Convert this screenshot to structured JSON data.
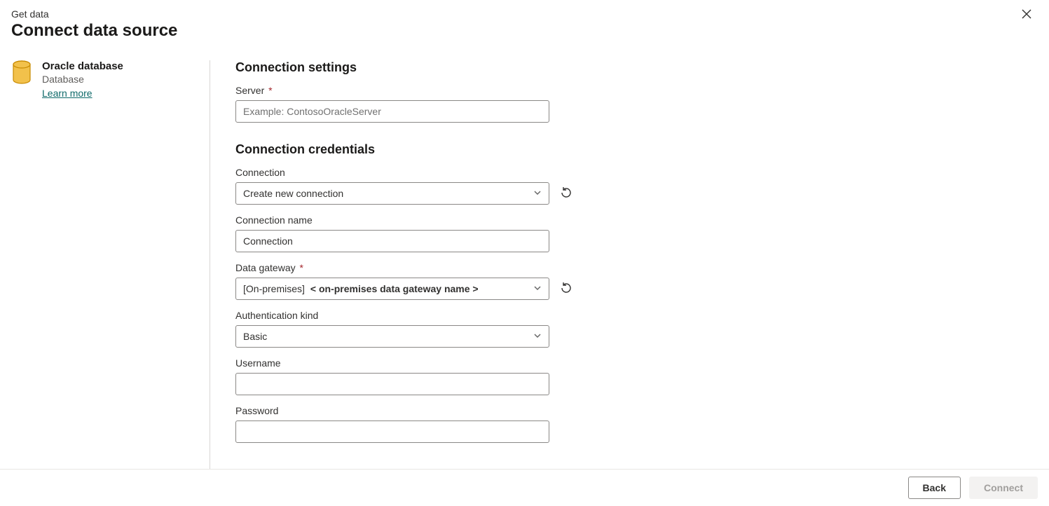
{
  "header": {
    "breadcrumb": "Get data",
    "title": "Connect data source"
  },
  "left": {
    "connector_name": "Oracle database",
    "connector_type": "Database",
    "learn_more": "Learn more"
  },
  "sections": {
    "settings": {
      "heading": "Connection settings",
      "server_label": "Server",
      "server_required": "*",
      "server_placeholder": "Example: ContosoOracleServer",
      "server_value": ""
    },
    "credentials": {
      "heading": "Connection credentials",
      "connection_label": "Connection",
      "connection_value": "Create new connection",
      "connection_name_label": "Connection name",
      "connection_name_value": "Connection",
      "data_gateway_label": "Data gateway",
      "data_gateway_required": "*",
      "data_gateway_prefix": "[On-premises]",
      "data_gateway_hint": "< on-premises data gateway name >",
      "auth_kind_label": "Authentication kind",
      "auth_kind_value": "Basic",
      "username_label": "Username",
      "username_value": "",
      "password_label": "Password",
      "password_value": ""
    }
  },
  "footer": {
    "back": "Back",
    "connect": "Connect"
  }
}
